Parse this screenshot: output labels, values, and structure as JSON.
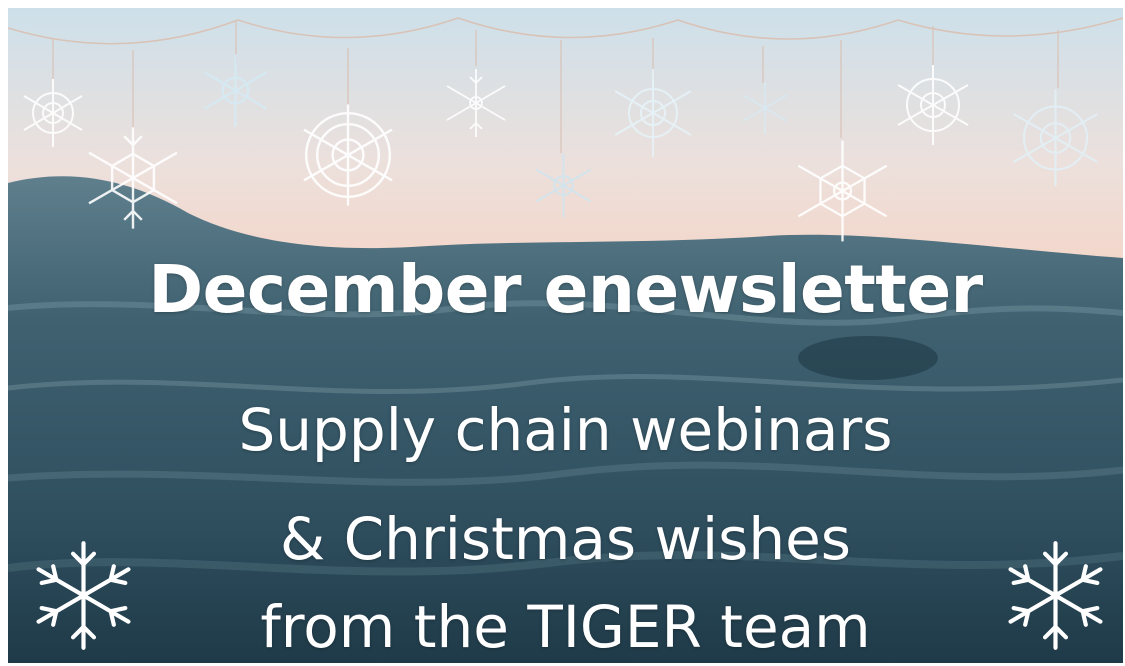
{
  "banner": {
    "headline": "December enewsletter",
    "lines": [
      "Supply chain webinars",
      "& Christmas wishes",
      "from the TIGER team"
    ]
  },
  "decorations": {
    "icons": [
      "hanging-snowflake-icon",
      "snowflake-icon",
      "garland-icon",
      "ocean-wave-background"
    ],
    "colors": {
      "text": "#ffffff",
      "sky": "#f1d8cf",
      "sea": "#2e4e5e"
    }
  }
}
